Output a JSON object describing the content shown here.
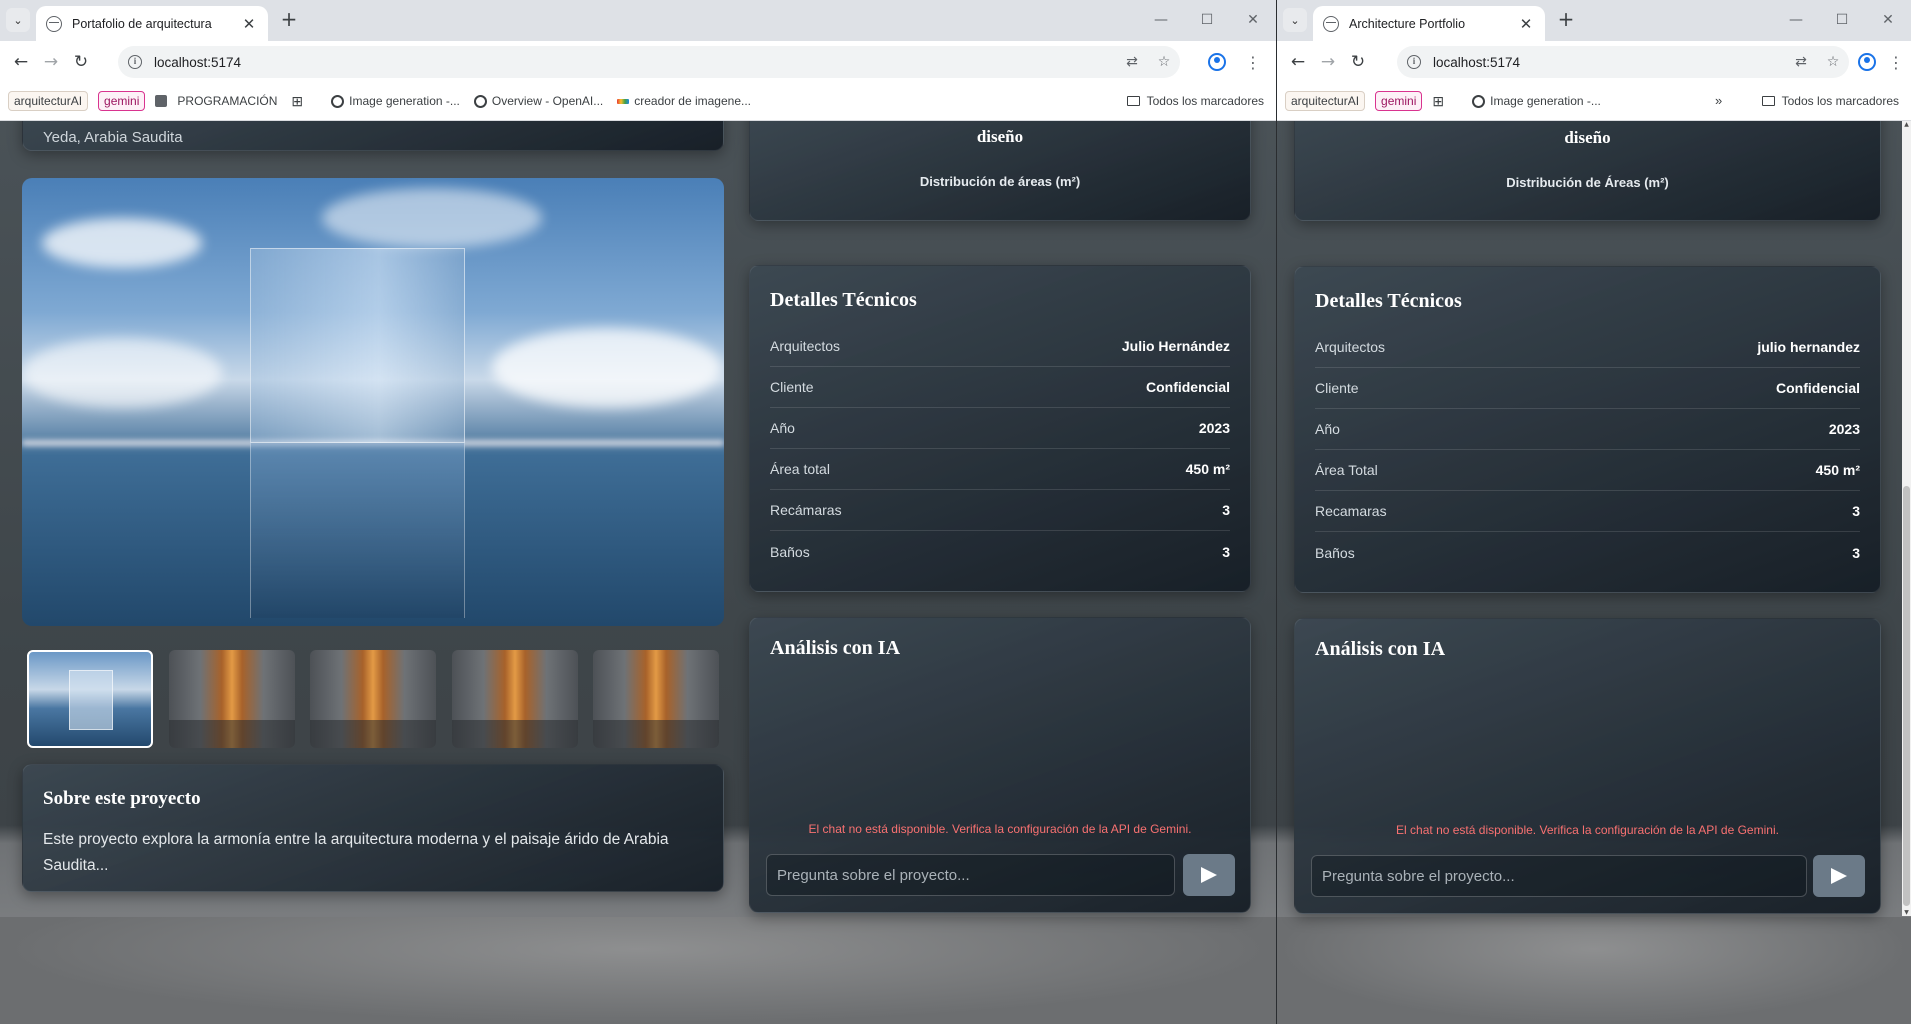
{
  "left_window": {
    "tab_title": "Portafolio de arquitectura",
    "url": "localhost:5174",
    "bookmarks": [
      "arquitecturAI",
      "gemini",
      "PROGRAMACIÓN",
      "Image generation -...",
      "Overview - OpenAI...",
      "creador de imagene..."
    ],
    "all_bookmarks": "Todos los marcadores",
    "location_text": "Yeda, Arabia Saudita",
    "about": {
      "title": "Sobre este proyecto",
      "text": "Este proyecto explora la armonía entre la arquitectura moderna y el paisaje árido de Arabia Saudita..."
    },
    "chart_card": {
      "title": "diseño",
      "subtitle": "Distribución de áreas (m²)"
    },
    "specs": {
      "title": "Detalles Técnicos",
      "rows": [
        {
          "label": "Arquitectos",
          "value": "Julio Hernández"
        },
        {
          "label": "Cliente",
          "value": "Confidencial"
        },
        {
          "label": "Año",
          "value": "2023"
        },
        {
          "label": "Área total",
          "value": "450 m²"
        },
        {
          "label": "Recámaras",
          "value": "3"
        },
        {
          "label": "Baños",
          "value": "3"
        }
      ]
    },
    "ai": {
      "title": "Análisis con IA",
      "error": "El chat no está disponible. Verifica la configuración de la API de Gemini.",
      "placeholder": "Pregunta sobre el proyecto..."
    }
  },
  "right_window": {
    "tab_title": "Architecture Portfolio",
    "url": "localhost:5174",
    "bookmarks": [
      "arquitecturAI",
      "gemini",
      "Image generation -..."
    ],
    "all_bookmarks": "Todos los marcadores",
    "chart_card": {
      "title": "diseño",
      "subtitle": "Distribución de Áreas (m²)"
    },
    "specs": {
      "title": "Detalles Técnicos",
      "rows": [
        {
          "label": "Arquitectos",
          "value": "julio hernandez"
        },
        {
          "label": "Cliente",
          "value": "Confidencial"
        },
        {
          "label": "Año",
          "value": "2023"
        },
        {
          "label": "Área Total",
          "value": "450 m²"
        },
        {
          "label": "Recamaras",
          "value": "3"
        },
        {
          "label": "Baños",
          "value": "3"
        }
      ]
    },
    "ai": {
      "title": "Análisis con IA",
      "error": "El chat no está disponible. Verifica la configuración de la API de Gemini.",
      "placeholder": "Pregunta sobre el proyecto..."
    }
  },
  "icons": {
    "back": "arrow-left-icon",
    "forward": "arrow-right-icon",
    "reload": "reload-icon",
    "translate": "translate-icon",
    "bookmark_star": "star-icon",
    "profile": "profile-icon",
    "menu": "kebab-menu-icon",
    "send": "send-icon"
  },
  "colors": {
    "error": "#f87171",
    "send_button": "#6b7a88",
    "gemini_pill": "#d9338f"
  }
}
